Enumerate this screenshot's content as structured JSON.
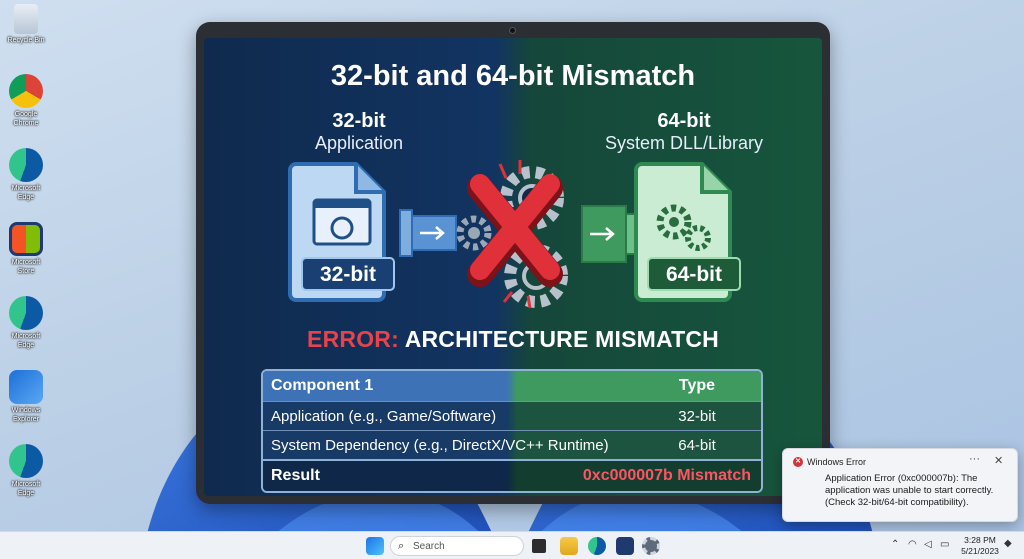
{
  "desktop": {
    "icons": [
      {
        "label": "Recycle Bin",
        "icon": "recycle-bin-icon"
      },
      {
        "label": "Google Chrome",
        "icon": "chrome-icon"
      },
      {
        "label": "Microsoft Edge",
        "icon": "edge-icon"
      },
      {
        "label": "Microsoft Store",
        "icon": "store-icon"
      },
      {
        "label": "Microsoft Edge",
        "icon": "edge-icon"
      },
      {
        "label": "Windows Explorer",
        "icon": "explorer-icon"
      },
      {
        "label": "Microsoft Edge",
        "icon": "edge-icon"
      }
    ]
  },
  "slide": {
    "title": "32-bit and 64-bit Mismatch",
    "left": {
      "bits": "32-bit",
      "name": "Application",
      "badge": "32-bit"
    },
    "right": {
      "bits": "64-bit",
      "name": "System DLL/Library",
      "badge": "64-bit"
    },
    "error_prefix": "ERROR:",
    "error_text": " ARCHITECTURE MISMATCH",
    "table": {
      "headers": [
        "Component 1",
        "Type"
      ],
      "rows": [
        [
          "Application (e.g., Game/Software)",
          "32-bit"
        ],
        [
          "System Dependency (e.g., DirectX/VC++ Runtime)",
          "64-bit"
        ]
      ],
      "result_label": "Result",
      "result_value": "0xc000007b Mismatch"
    },
    "colors": {
      "left_bg": "#123462",
      "right_bg": "#17563d",
      "error": "#e8434a"
    }
  },
  "toast": {
    "app": "Windows Error",
    "more": "···",
    "close": "✕",
    "message": "Application Error (0xc000007b): The application was unable to start correctly. (Check 32-bit/64-bit compatibility)."
  },
  "taskbar": {
    "search_placeholder": "Search",
    "time": "3:28 PM",
    "date": "5/21/2023"
  }
}
